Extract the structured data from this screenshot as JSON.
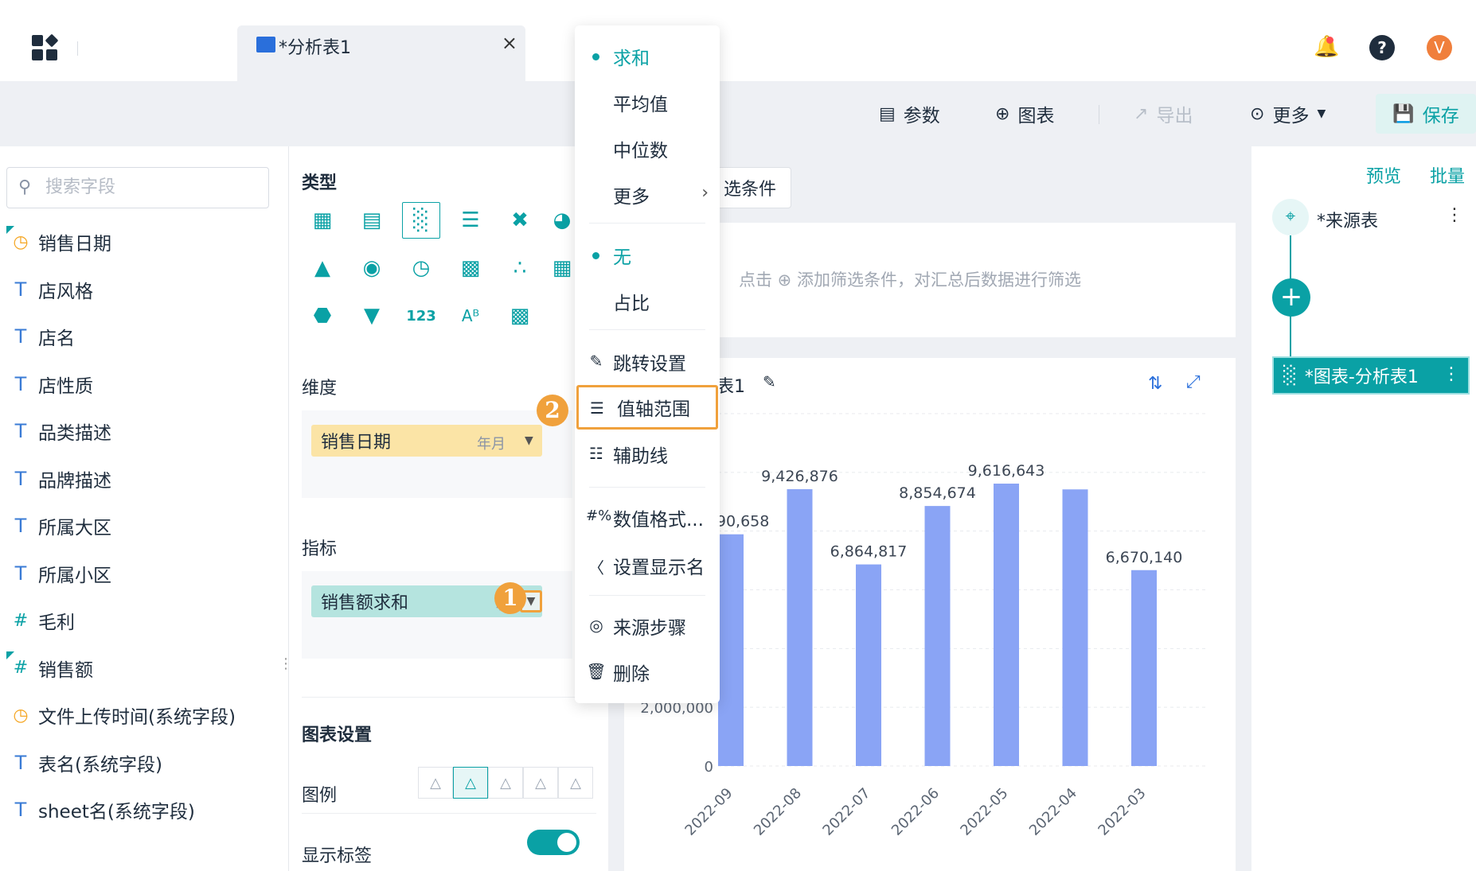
{
  "tab": {
    "title": "*分析表1",
    "close": "×"
  },
  "topbar": {
    "help": "?",
    "avatar": "V"
  },
  "toolbar": {
    "params": "参数",
    "chart": "图表",
    "export": "导出",
    "more": "更多",
    "save": "保存"
  },
  "fields": {
    "search_placeholder": "搜索字段",
    "items": [
      {
        "label": "销售日期",
        "kind": "time-new"
      },
      {
        "label": "店风格",
        "kind": "text"
      },
      {
        "label": "店名",
        "kind": "text"
      },
      {
        "label": "店性质",
        "kind": "text"
      },
      {
        "label": "品类描述",
        "kind": "text"
      },
      {
        "label": "品牌描述",
        "kind": "text"
      },
      {
        "label": "所属大区",
        "kind": "text"
      },
      {
        "label": "所属小区",
        "kind": "text"
      },
      {
        "label": "毛利",
        "kind": "number"
      },
      {
        "label": "销售额",
        "kind": "number-new"
      },
      {
        "label": "文件上传时间(系统字段)",
        "kind": "time"
      },
      {
        "label": "表名(系统字段)",
        "kind": "text"
      },
      {
        "label": "sheet名(系统字段)",
        "kind": "text"
      }
    ]
  },
  "config": {
    "type_title": "类型",
    "dimension_title": "维度",
    "dimension_pill": {
      "label": "销售日期",
      "sub": "年月"
    },
    "indicator_title": "指标",
    "indicator_pill": {
      "label": "销售额求和",
      "sub": "和"
    },
    "chart_settings_title": "图表设置",
    "legend_label": "图例",
    "show_label": "显示标签",
    "badge1": "1",
    "badge2": "2"
  },
  "main": {
    "filter_button": "选条件",
    "filter_hint": "点击 ⊕ 添加筛选条件，对汇总后数据进行筛选",
    "chart_title": "表1"
  },
  "flow": {
    "preview": "预览",
    "batch": "批量",
    "source": "*来源表",
    "chart_node": "*图表-分析表1"
  },
  "menu": {
    "agg": [
      "求和",
      "平均值",
      "中位数",
      "更多"
    ],
    "ratio": [
      "无",
      "占比"
    ],
    "actions": [
      "跳转设置",
      "值轴范围",
      "辅助线",
      "数值格式...",
      "设置显示名",
      "来源步骤",
      "删除"
    ]
  },
  "chart_data": {
    "type": "bar",
    "categories": [
      "2022-09",
      "2022-08",
      "2022-07",
      "2022-06",
      "2022-05",
      "2022-04",
      "2022-03"
    ],
    "series": [
      {
        "values": [
          7890658,
          9426876,
          6864817,
          8854674,
          9616643,
          9420000,
          6670140
        ]
      }
    ],
    "data_labels": [
      "7,890,658",
      "9,426,876",
      "6,864,817",
      "8,854,674",
      "9,616,643",
      "",
      "6,670,140"
    ],
    "y_ticks": [
      "0",
      "2,000,000",
      "0",
      "0",
      "0",
      "0",
      "0"
    ],
    "ylim": [
      0,
      12000000
    ],
    "color": "#8aa4f5"
  }
}
